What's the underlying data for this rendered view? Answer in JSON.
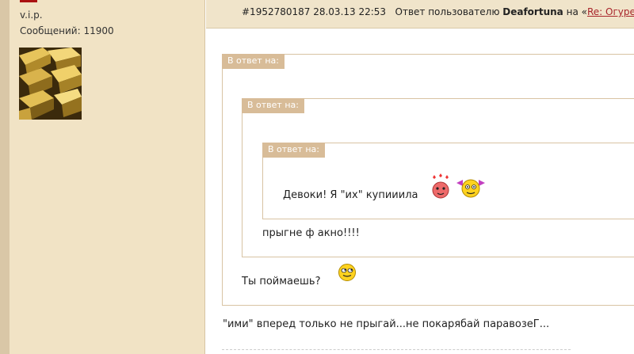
{
  "sidebar": {
    "role": "v.i.p.",
    "posts_count": "Сообщений: 11900"
  },
  "header": {
    "post_meta": "#1952780187 28.03.13 22:53",
    "reply_prefix": "Ответ пользователю",
    "reply_user": "Deafortuna",
    "on_label": "на «",
    "thread_link": "Re: Огуреееее"
  },
  "quotes": {
    "outer_label": "В ответ на:",
    "middle_label": "В ответ на:",
    "inner_label": "В ответ на:",
    "inner_text": "Девоки! Я \"их\" купииила",
    "middle_text": "прыгне ф акно!!!!",
    "outer_text": "Ты поймаешь?"
  },
  "reply_text": "\"ими\" вперед только не прыгай...не покарябай паравозеГ...",
  "colors": {
    "sidebar_bg": "#f1e3c5",
    "quote_label_bg": "#d8bc98",
    "link": "#a8252b"
  },
  "icons": [
    "gold-bars-avatar",
    "blushing-smiley-icon",
    "bow-smiley-icon",
    "rolling-eyes-smiley-icon"
  ]
}
